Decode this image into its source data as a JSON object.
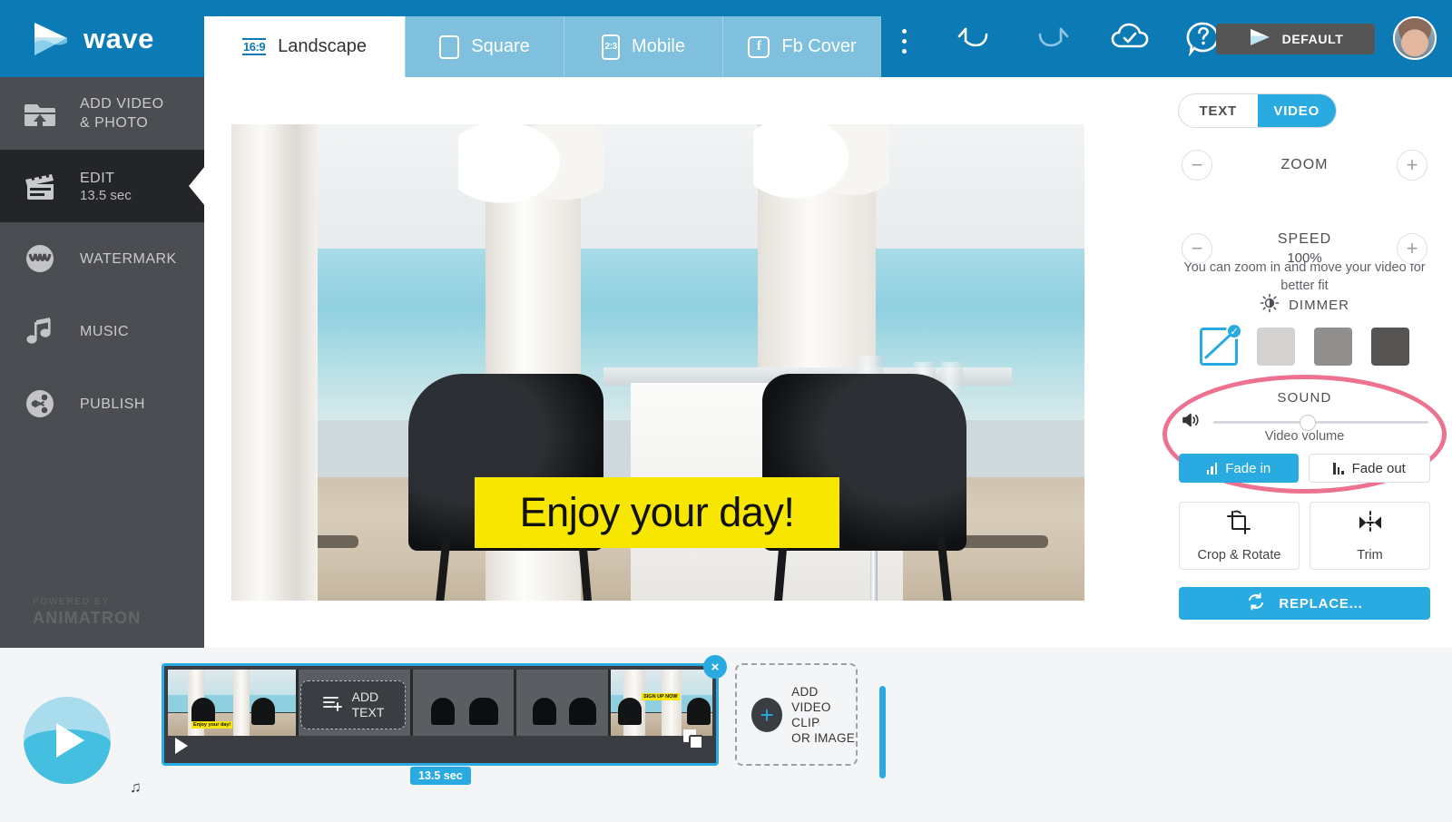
{
  "app": {
    "brand": "wave",
    "logo_icon": "wave-play-logo"
  },
  "header": {
    "tabs": [
      {
        "label": "Landscape",
        "icon": "aspect-16-9-icon",
        "icon_text": "16:9",
        "active": true
      },
      {
        "label": "Square",
        "icon": "square-frame-icon",
        "icon_text": "",
        "active": false
      },
      {
        "label": "Mobile",
        "icon": "aspect-2-3-icon",
        "icon_text": "2:3",
        "active": false
      },
      {
        "label": "Fb Cover",
        "icon": "facebook-icon",
        "icon_text": "f",
        "active": false
      }
    ],
    "kebab_icon": "more-options-icon",
    "undo_icon": "undo-icon",
    "redo_icon": "redo-icon",
    "save_icon": "cloud-saved-icon",
    "help_icon": "help-circle-icon",
    "default_button": {
      "label": "DEFAULT",
      "icon": "wave-play-logo"
    },
    "avatar": "user-avatar"
  },
  "sidebar": {
    "items": [
      {
        "label": "ADD VIDEO",
        "label2": "& PHOTO",
        "sub": "",
        "icon": "upload-folder-icon",
        "active": false
      },
      {
        "label": "EDIT",
        "label2": "",
        "sub": "13.5 sec",
        "icon": "clapperboard-icon",
        "active": true
      },
      {
        "label": "WATERMARK",
        "label2": "",
        "sub": "",
        "icon": "watermark-w-icon",
        "active": false
      },
      {
        "label": "MUSIC",
        "label2": "",
        "sub": "",
        "icon": "music-note-icon",
        "active": false
      },
      {
        "label": "PUBLISH",
        "label2": "",
        "sub": "",
        "icon": "share-icon",
        "active": false
      }
    ],
    "powered_by": "POWERED BY",
    "powered_brand": "ANIMATRON"
  },
  "canvas": {
    "caption_text": "Enjoy your day!",
    "caption_bg": "#f7e600"
  },
  "right_panel": {
    "segmented": {
      "text_label": "TEXT",
      "video_label": "VIDEO",
      "selected": "VIDEO"
    },
    "zoom": {
      "title": "ZOOM",
      "value": "",
      "minus": "−",
      "plus": "+"
    },
    "zoom_hint": "You can zoom in and move your video for better fit",
    "speed": {
      "title": "SPEED",
      "value": "100%",
      "minus": "−",
      "plus": "+"
    },
    "dimmer": {
      "title": "DIMMER",
      "icon": "brightness-icon",
      "swatches": [
        {
          "name": "no-dimmer",
          "color": "",
          "selected": true
        },
        {
          "name": "light-dimmer",
          "color": "#d4d2d0",
          "selected": false
        },
        {
          "name": "medium-dimmer",
          "color": "#908f8d",
          "selected": false
        },
        {
          "name": "dark-dimmer",
          "color": "#555452",
          "selected": false
        }
      ]
    },
    "sound": {
      "title": "SOUND",
      "volume_icon": "speaker-icon",
      "volume_label": "Video volume",
      "volume_percent": 44,
      "fade_in": "Fade in",
      "fade_out": "Fade out",
      "highlight_color": "#ed7290"
    },
    "tools": [
      {
        "label": "Crop & Rotate",
        "icon": "crop-rotate-icon"
      },
      {
        "label": "Trim",
        "icon": "trim-icon"
      }
    ],
    "replace_button": {
      "label": "REPLACE...",
      "icon": "replace-refresh-icon"
    }
  },
  "timeline": {
    "play_button": "play-preview-button",
    "music_note_icon": "music-note-icon",
    "duration_badge": "13.5 sec",
    "clip_close": "×",
    "clip_play_icon": "play-clip-icon",
    "clip_duplicate_icon": "duplicate-clip-icon",
    "add_text": {
      "line1": "ADD",
      "line2": "TEXT",
      "icon": "add-text-icon"
    },
    "thumb_tag_1": "Enjoy your day!",
    "thumb_tag_2": "SIGN UP NOW",
    "add_clip": {
      "line1": "ADD",
      "line2": "VIDEO CLIP",
      "line3": "OR IMAGE",
      "icon": "plus-icon"
    }
  },
  "colors": {
    "header_blue": "#0b7ab5",
    "accent_blue": "#29abe2",
    "tab_inactive": "#7ec0dd",
    "sidebar": "#4b4d52",
    "sidebar_active": "#242528",
    "pink_highlight": "#ed7290",
    "caption_yellow": "#f7e600"
  }
}
